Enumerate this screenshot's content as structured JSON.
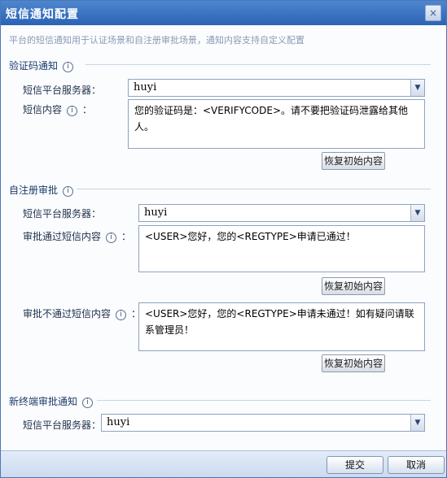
{
  "window": {
    "title": "短信通知配置",
    "close_glyph": "×"
  },
  "description": "平台的短信通知用于认证场景和自注册审批场景，通知内容支持自定义配置",
  "sections": [
    {
      "title": "验证码通知",
      "server_label": "短信平台服务器：",
      "server_value": "huyi",
      "content_label": "短信内容",
      "content_suffix": "：",
      "content_value": "您的验证码是：<VERIFYCODE>。请不要把验证码泄露给其他人。",
      "reset_label": "恢复初始内容"
    },
    {
      "title": "自注册审批",
      "server_label": "短信平台服务器：",
      "server_value": "huyi",
      "pass_label": "审批通过短信内容",
      "pass_value": "<USER>您好，您的<REGTYPE>申请已通过！",
      "pass_reset_label": "恢复初始内容",
      "fail_label": "审批不通过短信内容",
      "fail_value": "<USER>您好，您的<REGTYPE>申请未通过！如有疑问请联系管理员！",
      "fail_reset_label": "恢复初始内容",
      "label_suffix": "："
    },
    {
      "title": "新终端审批通知",
      "server_label": "短信平台服务器：",
      "server_value": "huyi"
    }
  ],
  "icons": {
    "info": "i",
    "dropdown": "▼"
  },
  "footer": {
    "submit_label": "提交",
    "cancel_label": "取消"
  }
}
